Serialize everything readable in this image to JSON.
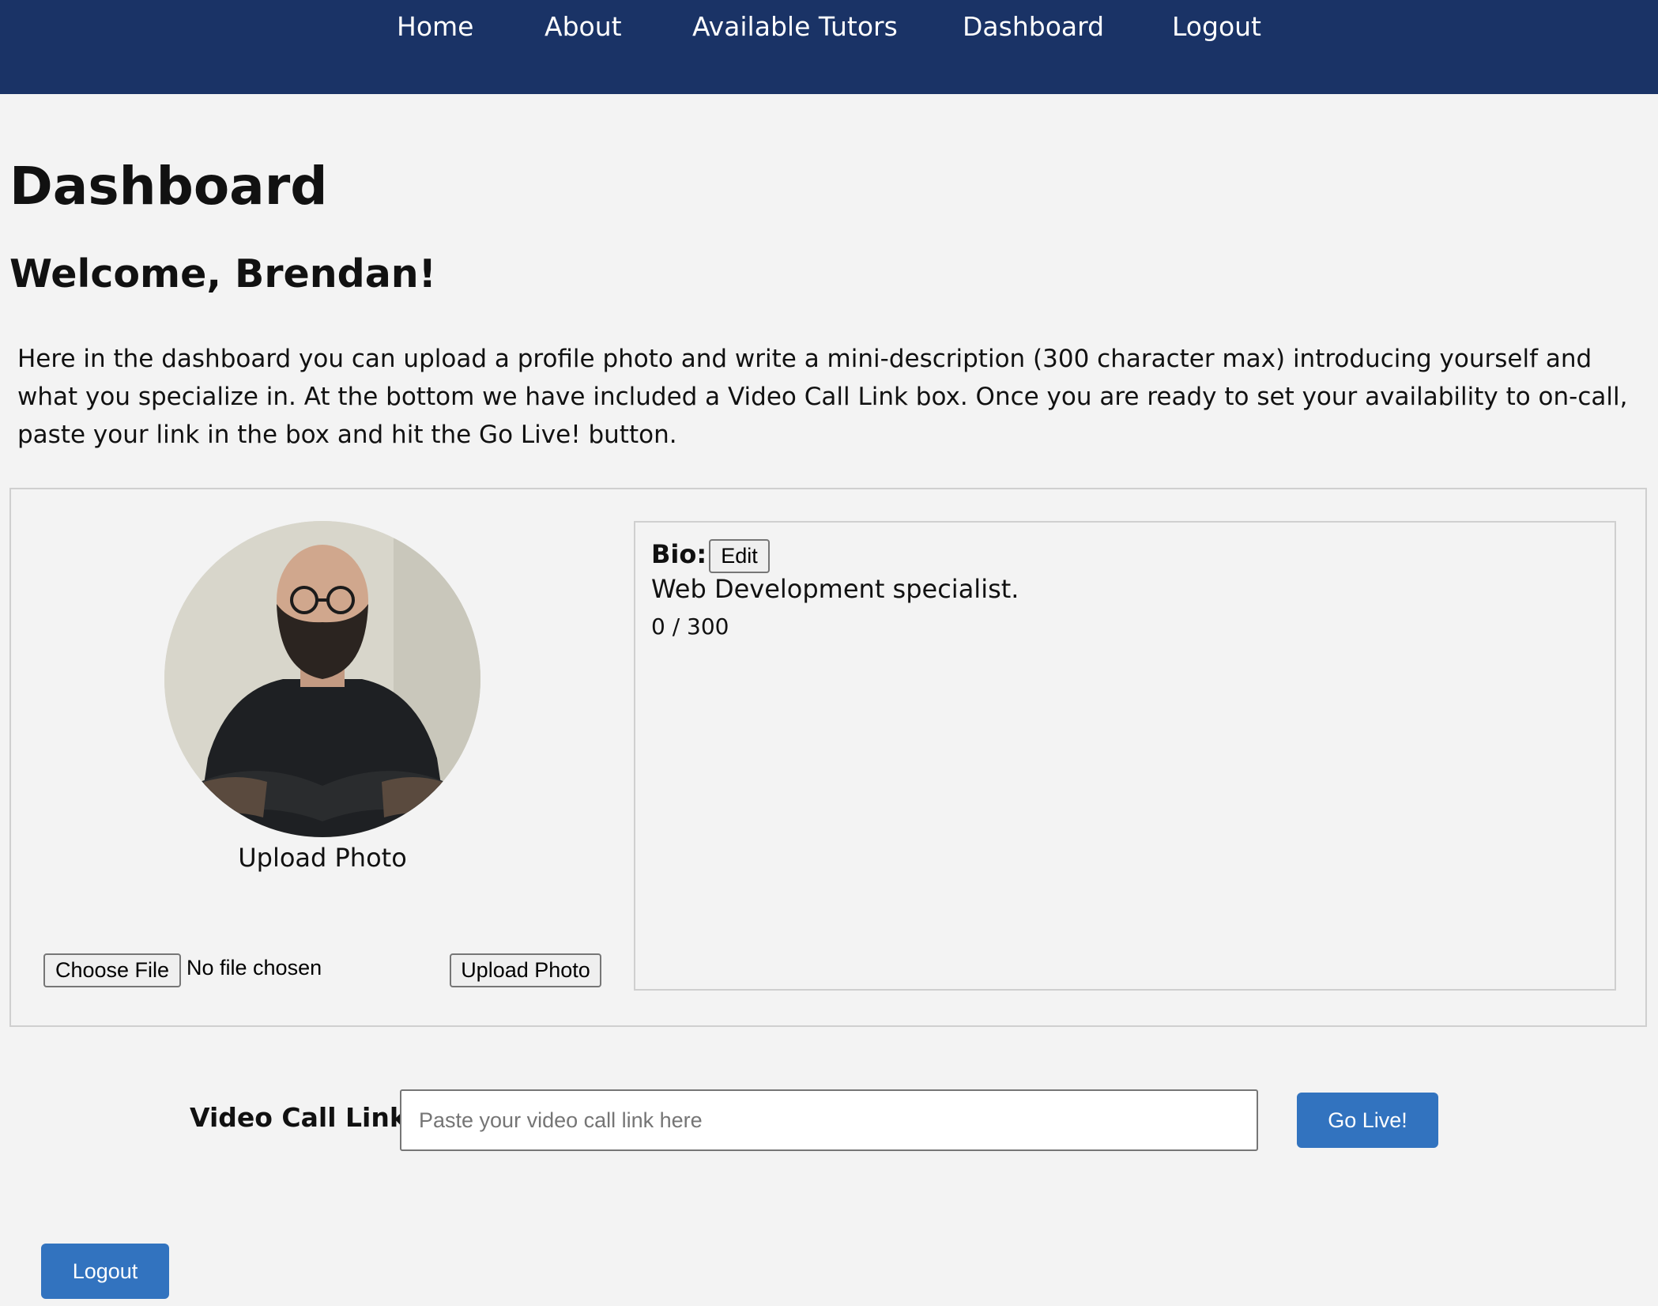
{
  "nav": {
    "items": [
      {
        "label": "Home"
      },
      {
        "label": "About"
      },
      {
        "label": "Available Tutors"
      },
      {
        "label": "Dashboard"
      },
      {
        "label": "Logout"
      }
    ]
  },
  "page": {
    "title": "Dashboard",
    "welcome": "Welcome, Brendan!",
    "intro": "Here in the dashboard you can upload a profile photo and write a mini-description (300 character max) introducing yourself and what you specialize in. At the bottom we have included a Video Call Link box. Once you are ready to set your availability to on-call, paste your link in the box and hit the Go Live! button."
  },
  "profile": {
    "avatar_icon": "profile-photo",
    "upload_caption": "Upload Photo",
    "choose_file_label": "Choose File",
    "file_status": "No file chosen",
    "upload_button_label": "Upload Photo"
  },
  "bio": {
    "label": "Bio:",
    "edit_label": "Edit",
    "text": "Web Development specialist.",
    "counter": "0 / 300"
  },
  "video_call": {
    "label": "Video Call Link:",
    "placeholder": "Paste your video call link here",
    "value": "",
    "go_live_label": "Go Live!"
  },
  "footer": {
    "logout_label": "Logout"
  },
  "colors": {
    "navbar": "#1a3366",
    "background": "#f3f3f3",
    "primary_button": "#3273bf"
  }
}
